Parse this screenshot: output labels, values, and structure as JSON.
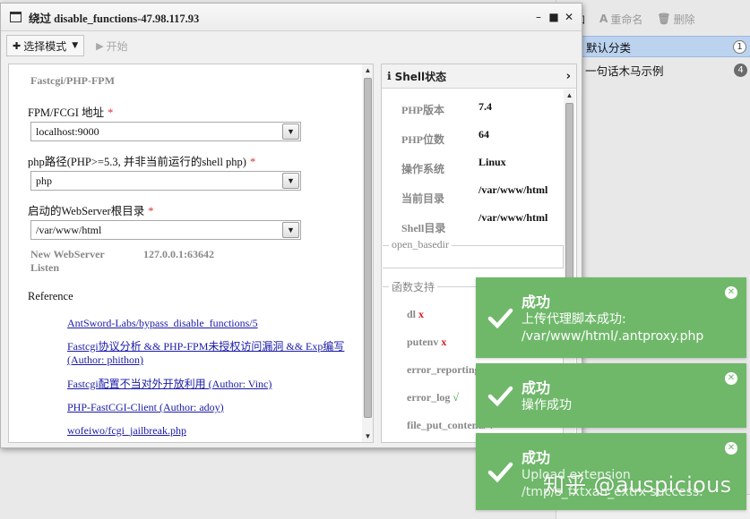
{
  "window": {
    "title": "绕过 disable_functions-47.98.117.93",
    "controls": {
      "minimize": "–",
      "maximize": "■",
      "close": "✕"
    }
  },
  "toolbar": {
    "mode_label": "选择模式",
    "start_label": "开始"
  },
  "form": {
    "section_title": "Fastcgi/PHP-FPM",
    "fpm_label": "FPM/FCGI 地址",
    "fpm_value": "localhost:9000",
    "php_path_label": "php路径(PHP>=5.3, 并非当前运行的shell php)",
    "php_path_value": "php",
    "webroot_label": "启动的WebServer根目录",
    "webroot_value": "/var/www/html",
    "required_mark": "*",
    "new_server_key": "New WebServer Listen",
    "new_server_value": "127.0.0.1:63642",
    "reference_label": "Reference",
    "references": [
      "AntSword-Labs/bypass_disable_functions/5",
      "Fastcgi协议分析 && PHP-FPM未授权访问漏洞 && Exp编写(Author: phithon)",
      "Fastcgi配置不当对外开放利用 (Author: Vinc)",
      "PHP-FastCGI-Client (Author: adoy)",
      "wofeiwo/fcgi_jailbreak.php"
    ]
  },
  "shell_status": {
    "title": "Shell状态",
    "stats": [
      {
        "key": "PHP版本",
        "value": "7.4"
      },
      {
        "key": "PHP位数",
        "value": "64"
      },
      {
        "key": "操作系统",
        "value": "Linux"
      },
      {
        "key": "当前目录",
        "value": "/var/www/html"
      },
      {
        "key": "Shell目录",
        "value": "/var/www/html"
      }
    ],
    "open_basedir_label": "open_basedir",
    "functions_label": "函数支持",
    "functions": [
      {
        "name": "dl",
        "mark": "x"
      },
      {
        "name": "putenv",
        "mark": "x"
      },
      {
        "name": "error_reporting",
        "mark": "√"
      },
      {
        "name": "error_log",
        "mark": "√"
      },
      {
        "name": "file_put_contents",
        "mark": "√"
      }
    ]
  },
  "background_panel": {
    "toolbar": {
      "add": "添加",
      "rename": "重命名",
      "delete": "删除"
    },
    "categories": [
      {
        "label": "默认分类",
        "count": "1"
      },
      {
        "label": "一句话木马示例",
        "count": "4"
      }
    ]
  },
  "toasts": [
    {
      "title": "成功",
      "message_lines": [
        "上传代理脚本成功:",
        "/var/www/html/.antproxy.php"
      ]
    },
    {
      "title": "成功",
      "message_lines": [
        "操作成功"
      ]
    },
    {
      "title": "成功",
      "message_lines": [
        "Upload extension",
        "/tmp/s_fxtxan_extrx success."
      ]
    }
  ],
  "watermark": "知乎 @auspicious",
  "colors": {
    "toast_green": "#6fb86a",
    "link_blue": "#1a1aa6",
    "required_red": "#d33333",
    "selected_row": "#bcd3f0"
  }
}
